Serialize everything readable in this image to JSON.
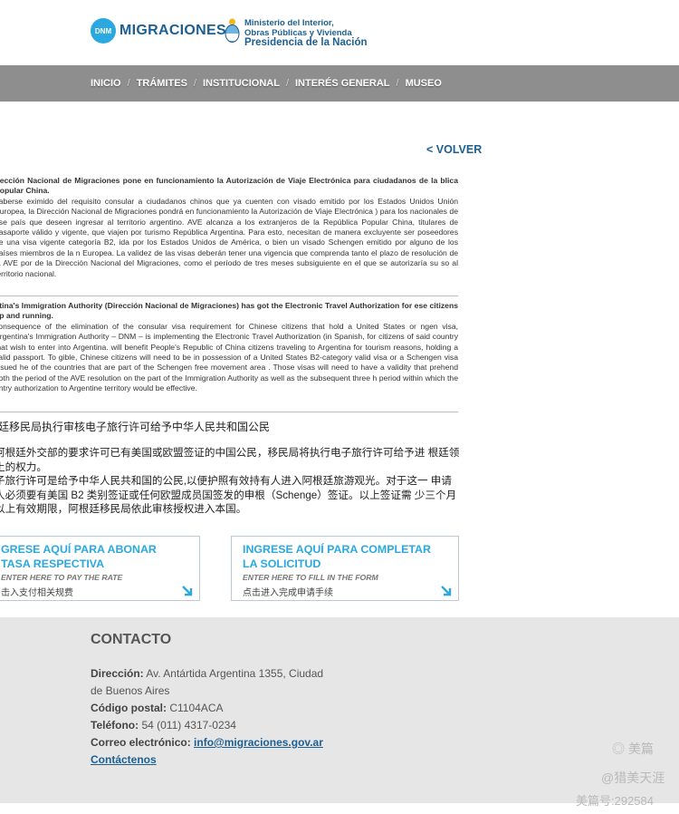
{
  "header": {
    "dnm_badge": "DNM",
    "dnm_name": "MIGRACIONES",
    "gov_line1": "Ministerio del Interior,",
    "gov_line2": "Obras Públicas y Vivienda",
    "gov_line3": "Presidencia de la Nación"
  },
  "nav": {
    "items": [
      "INICIO",
      "TRÁMITES",
      "INSTITUCIONAL",
      "INTERÉS GENERAL",
      "MUSEO"
    ],
    "separator": "/"
  },
  "back_link": "< VOLVER",
  "spanish": {
    "title": "irección Nacional de Migraciones pone en funcionamiento la Autorización de Viaje Electrónica para ciudadanos de la blica Popular China.",
    "body": "haberse eximido del requisito consular a ciudadanos chinos que ya cuenten con visado emitido por los Estados Unidos Unión Europea, la Dirección Nacional de Migraciones pondrá en funcionamiento la Autorización de Viaje Electrónica ) para los nacionales de ese país que deseen ingresar al territorio argentino. AVE alcanza a los extranjeros de la República Popular China, titulares de pasaporte válido y vigente, que viajen por turismo República Argentina. Para esto, necesitan de manera excluyente ser poseedores de una visa vigente categoría B2, ida por los Estados Unidos de América, o bien un visado Schengen emitido por alguno de los países miembros de la n Europea. La validez de las visas deberán tener una vigencia que comprenda tanto el plazo de resolución de la AVE por de la Dirección Nacional del Migraciones, como el período de tres meses subsiguiente en el que se autorizaría su so al territorio nacional."
  },
  "english": {
    "title": "ntina's Immigration Authority (Dirección Nacional de Migraciones) has got the Electronic Travel Authorization for ese citizens up and running.",
    "body": "consequence of the elimination of the consular visa requirement for Chinese citizens that hold a United States or ngen visa, Argentina's Immigration Authority – DNM – is implementing the Electronic Travel Authorization (in Spanish, for citizens of said country that wish to enter into Argentina. will benefit People's Republic of China citizens traveling to Argentina for tourism reasons, holding a valid passport. To gible, Chinese citizens will need to be in possession of a United States B2-category valid visa or a Schengen visa issued he of the countries that are part of the Schengen free movement area . Those visas will need to have a validity that prehend both the period of the AVE resolution on the part of the Immigration Authority as well as the subsequent three h period within which the entry authorization to Argentine territory would be effective."
  },
  "chinese": {
    "title": "廷移民局执行审核电子旅行许可给予中华人民共和国公民",
    "p1": "阿根廷外交部的要求许可已有美国或欧盟签证的中国公民，移民局将执行电子旅行许可给予进 根廷领土的权力。",
    "p2": "子旅行许可是给予中华人民共和国的公民,以便护照有效持有人进入阿根廷旅游观光。对于这一 申请人必须要有美国 B2 类别签证或任何欧盟成员国签发的申根（Schenge）签证。以上签证需 少三个月以上有效期限，阿根廷移民局依此审核授权进入本国。"
  },
  "cta_left": {
    "title1": "GRESE AQUÍ PARA ABONAR",
    "title2": "TASA RESPECTIVA",
    "en": "ENTER HERE TO PAY THE RATE",
    "cn": "击入支付相关规费"
  },
  "cta_right": {
    "title1": "INGRESE AQUÍ PARA COMPLETAR",
    "title2": "LA SOLICITUD",
    "en": "ENTER HERE TO FILL IN THE FORM",
    "cn": "点击进入完成申请手续"
  },
  "contact": {
    "heading": "CONTACTO",
    "address_label": "Dirección:",
    "address_line1": "Av. Antártida Argentina 1355, Ciudad",
    "address_line2": "de Buenos Aires",
    "postal_label": "Código postal:",
    "postal": "C1104ACA",
    "phone_label": "Teléfono:",
    "phone": "54 (011) 4317-0234",
    "email_label": "Correo electrónico:",
    "email": "info@migraciones.gov.ar",
    "contact_link": "Contáctenos"
  },
  "watermark": {
    "brand": "美篇",
    "author": "@猎美天涯",
    "id": "美篇号:292584"
  },
  "colors": {
    "brand_blue": "#1c5f93",
    "accent_cyan": "#2aa8df",
    "nav_gray": "#8e8e8e",
    "footer_gray": "#e6e6e6"
  }
}
